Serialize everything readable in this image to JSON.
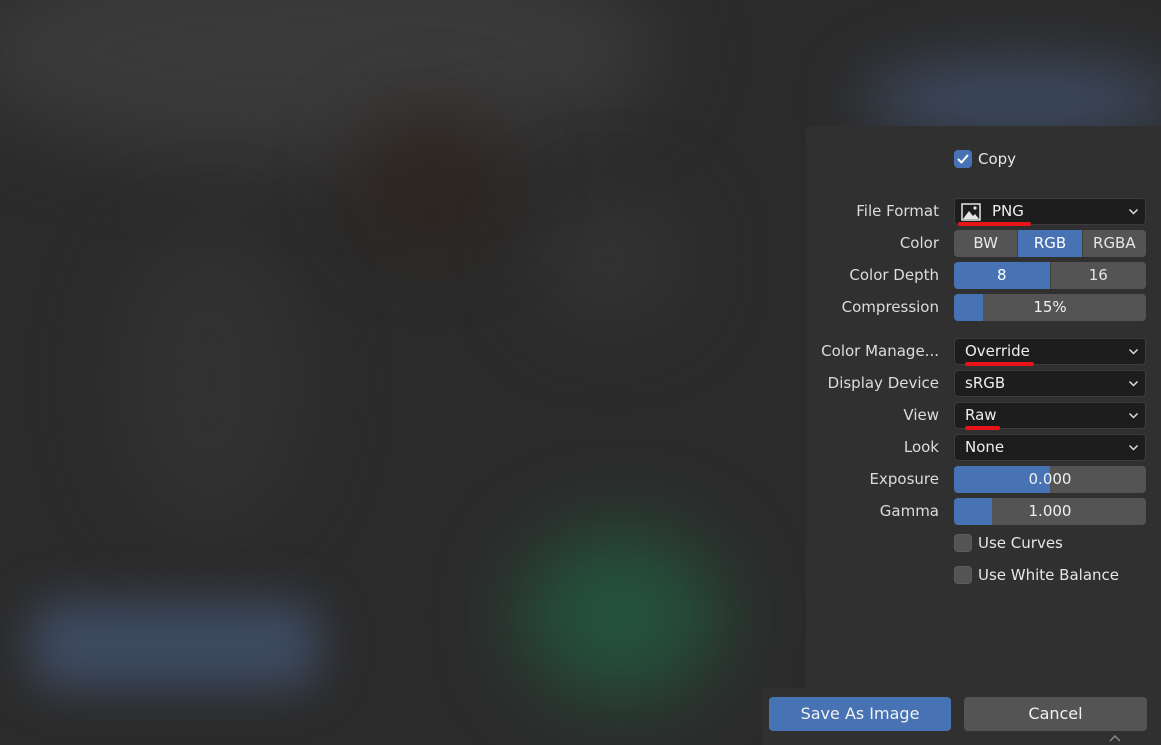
{
  "copy": {
    "label": "Copy",
    "checked": true
  },
  "file_format": {
    "label": "File Format",
    "value": "PNG",
    "icon": "image-icon"
  },
  "color": {
    "label": "Color",
    "options": [
      "BW",
      "RGB",
      "RGBA"
    ],
    "selected": "RGB"
  },
  "color_depth": {
    "label": "Color Depth",
    "options": [
      "8",
      "16"
    ],
    "selected": "8"
  },
  "compression": {
    "label": "Compression",
    "value": "15%",
    "fraction": 0.15
  },
  "color_management": {
    "label": "Color Manage...",
    "value": "Override"
  },
  "display_device": {
    "label": "Display Device",
    "value": "sRGB"
  },
  "view": {
    "label": "View",
    "value": "Raw"
  },
  "look": {
    "label": "Look",
    "value": "None"
  },
  "exposure": {
    "label": "Exposure",
    "value": "0.000",
    "fraction": 0.5
  },
  "gamma": {
    "label": "Gamma",
    "value": "1.000",
    "fraction": 0.2
  },
  "use_curves": {
    "label": "Use Curves",
    "checked": false
  },
  "use_white_balance": {
    "label": "Use White Balance",
    "checked": false
  },
  "buttons": {
    "save": "Save As Image",
    "cancel": "Cancel"
  },
  "colors": {
    "accent": "#4772b3",
    "annotation": "#e8141a",
    "panel": "#303030"
  }
}
